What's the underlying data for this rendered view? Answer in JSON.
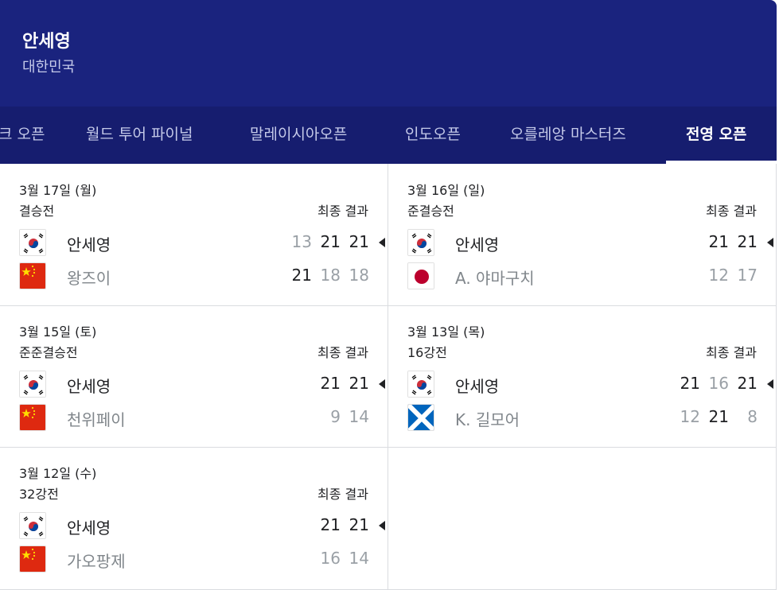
{
  "header": {
    "player_name": "안세영",
    "country": "대한민국"
  },
  "tabs": [
    {
      "label": "크 오픈",
      "active": false
    },
    {
      "label": "월드 투어 파이널",
      "active": false
    },
    {
      "label": "말레이시아오픈",
      "active": false
    },
    {
      "label": "인도오픈",
      "active": false
    },
    {
      "label": "오를레앙 마스터즈",
      "active": false
    },
    {
      "label": "전영 오픈",
      "active": true
    }
  ],
  "result_label": "최종 결과",
  "matches": [
    {
      "date": "3월 17일 (월)",
      "round": "결승전",
      "player1": {
        "name": "안세영",
        "flag": "korea-flag-icon",
        "scores": [
          "13",
          "21",
          "21"
        ],
        "won": [
          false,
          true,
          true
        ]
      },
      "player2": {
        "name": "왕즈이",
        "flag": "china-flag-icon",
        "scores": [
          "21",
          "18",
          "18"
        ],
        "won": [
          true,
          false,
          false
        ]
      }
    },
    {
      "date": "3월 16일 (일)",
      "round": "준결승전",
      "player1": {
        "name": "안세영",
        "flag": "korea-flag-icon",
        "scores": [
          "21",
          "21"
        ],
        "won": [
          true,
          true
        ]
      },
      "player2": {
        "name": "A. 야마구치",
        "flag": "japan-flag-icon",
        "scores": [
          "12",
          "17"
        ],
        "won": [
          false,
          false
        ]
      }
    },
    {
      "date": "3월 15일 (토)",
      "round": "준준결승전",
      "player1": {
        "name": "안세영",
        "flag": "korea-flag-icon",
        "scores": [
          "21",
          "21"
        ],
        "won": [
          true,
          true
        ]
      },
      "player2": {
        "name": "천위페이",
        "flag": "china-flag-icon",
        "scores": [
          "9",
          "14"
        ],
        "won": [
          false,
          false
        ]
      }
    },
    {
      "date": "3월 13일 (목)",
      "round": "16강전",
      "player1": {
        "name": "안세영",
        "flag": "korea-flag-icon",
        "scores": [
          "21",
          "16",
          "21"
        ],
        "won": [
          true,
          false,
          true
        ]
      },
      "player2": {
        "name": "K. 길모어",
        "flag": "scotland-flag-icon",
        "scores": [
          "12",
          "21",
          "8"
        ],
        "won": [
          false,
          true,
          false
        ]
      }
    },
    {
      "date": "3월 12일 (수)",
      "round": "32강전",
      "player1": {
        "name": "안세영",
        "flag": "korea-flag-icon",
        "scores": [
          "21",
          "21"
        ],
        "won": [
          true,
          true
        ]
      },
      "player2": {
        "name": "가오팡제",
        "flag": "china-flag-icon",
        "scores": [
          "16",
          "14"
        ],
        "won": [
          false,
          false
        ]
      }
    }
  ]
}
